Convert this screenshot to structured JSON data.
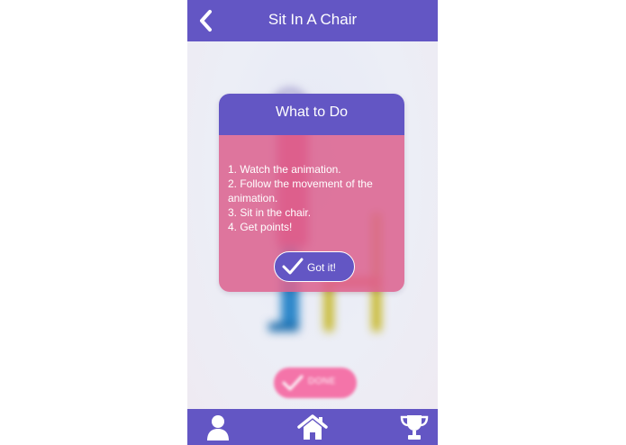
{
  "header": {
    "title": "Sit In A Chair",
    "back_icon": "chevron-left-icon"
  },
  "dialog": {
    "title": "What to Do",
    "instructions": [
      "1. Watch the animation.",
      "2. Follow the movement of the animation.",
      "3. Sit in the chair.",
      "4. Get points!"
    ],
    "confirm_label": "Got it!",
    "confirm_icon": "checkmark-icon"
  },
  "done_button": {
    "label": "DONE",
    "icon": "checkmark-icon"
  },
  "bottom_nav": {
    "items": [
      {
        "icon": "profile-icon"
      },
      {
        "icon": "home-icon"
      },
      {
        "icon": "trophy-icon"
      }
    ]
  },
  "colors": {
    "primary": "#6356c4",
    "dialog_body": "#dc6491",
    "done_button": "#f65f9c",
    "figure_shirt": "#e03a6e",
    "figure_pants": "#2b86c9",
    "chair": "#c4b41c",
    "chair_seat": "#e9612e"
  }
}
